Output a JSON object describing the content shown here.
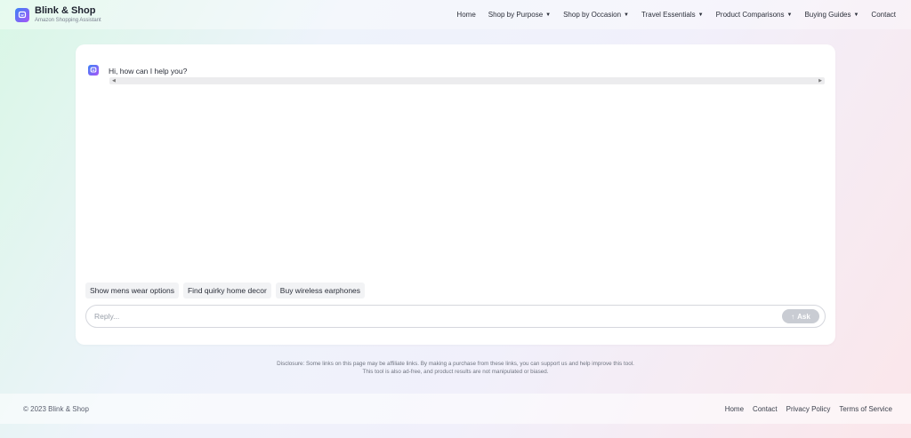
{
  "brand": {
    "title": "Blink & Shop",
    "subtitle": "Amazon Shopping Assistant",
    "icon": "chat-logo-icon"
  },
  "nav": [
    {
      "label": "Home",
      "dropdown": false
    },
    {
      "label": "Shop by Purpose",
      "dropdown": true
    },
    {
      "label": "Shop by Occasion",
      "dropdown": true
    },
    {
      "label": "Travel Essentials",
      "dropdown": true
    },
    {
      "label": "Product Comparisons",
      "dropdown": true
    },
    {
      "label": "Buying Guides",
      "dropdown": true
    },
    {
      "label": "Contact",
      "dropdown": false
    }
  ],
  "chat": {
    "greeting": "Hi, how can I help you?",
    "suggestions": [
      "Show mens wear options",
      "Find quirky home decor",
      "Buy wireless earphones"
    ],
    "reply_placeholder": "Reply...",
    "ask_label": "Ask"
  },
  "disclosure": {
    "line1": "Disclosure: Some links on this page may be affiliate links. By making a purchase from these links, you can support us and help improve this tool.",
    "line2": "This tool is also ad-free, and product results are not manipulated or biased."
  },
  "footer": {
    "copyright": "© 2023 Blink & Shop",
    "links": [
      "Home",
      "Contact",
      "Privacy Policy",
      "Terms of Service"
    ]
  },
  "colors": {
    "accent_start": "#3b82f6",
    "accent_end": "#a855f7",
    "ask_disabled": "#c9ccd3"
  }
}
